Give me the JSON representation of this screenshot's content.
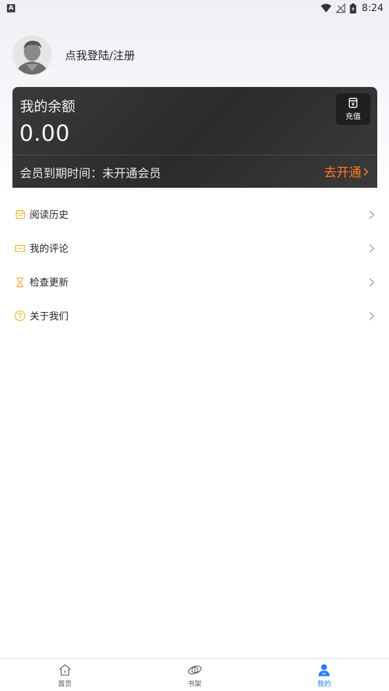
{
  "status_bar": {
    "indicator": "A",
    "time": "8:24"
  },
  "profile": {
    "login_text": "点我登陆/注册"
  },
  "balance": {
    "title": "我的余额",
    "amount": "0.00",
    "recharge_label": "充值",
    "vip_label": "会员到期时间：未开通会员",
    "vip_action": "去开通",
    "accent_color": "#ff7a1a"
  },
  "menu": [
    {
      "label": "阅读历史",
      "icon": "calendar-icon"
    },
    {
      "label": "我的评论",
      "icon": "ticket-icon"
    },
    {
      "label": "检查更新",
      "icon": "hourglass-icon"
    },
    {
      "label": "关于我们",
      "icon": "question-icon"
    }
  ],
  "nav": [
    {
      "label": "首页",
      "icon": "home-icon",
      "active": false
    },
    {
      "label": "书架",
      "icon": "bookshelf-icon",
      "active": false
    },
    {
      "label": "我的",
      "icon": "user-icon",
      "active": true
    }
  ],
  "colors": {
    "icon_yellow": "#f0b53a",
    "nav_active": "#2a7cf6"
  }
}
